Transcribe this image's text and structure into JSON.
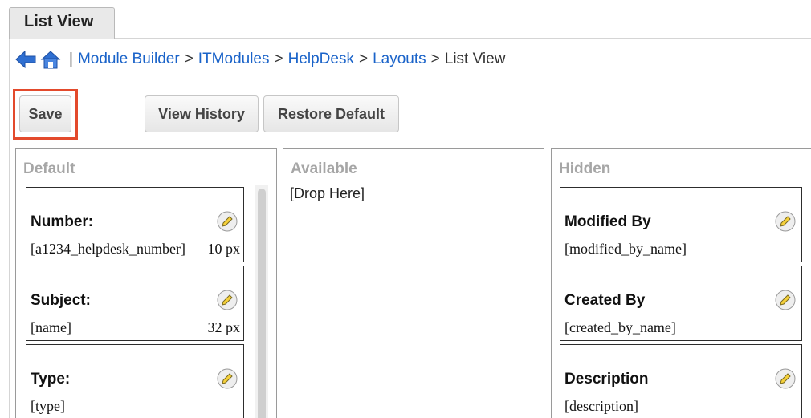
{
  "tab": {
    "label": "List View"
  },
  "breadcrumb": {
    "separator": "|",
    "links": [
      "Module Builder",
      "ITModules",
      "HelpDesk",
      "Layouts"
    ],
    "arrow": ">",
    "current": "List View"
  },
  "buttons": {
    "save": "Save",
    "view_history": "View History",
    "restore_default": "Restore Default"
  },
  "columns": {
    "default": {
      "title": "Default",
      "fields": [
        {
          "label": "Number:",
          "field": "[a1234_helpdesk_number]",
          "width": "10 px"
        },
        {
          "label": "Subject:",
          "field": "[name]",
          "width": "32 px"
        },
        {
          "label": "Type:",
          "field": "[type]",
          "width": ""
        }
      ]
    },
    "available": {
      "title": "Available",
      "drop_hint": "[Drop Here]"
    },
    "hidden": {
      "title": "Hidden",
      "fields": [
        {
          "label": "Modified By",
          "field": "[modified_by_name]"
        },
        {
          "label": "Created By",
          "field": "[created_by_name]"
        },
        {
          "label": "Description",
          "field": "[description]"
        }
      ]
    }
  },
  "colors": {
    "link": "#1a63c9",
    "highlight": "#e34a2c",
    "column_title": "#a6a6a6"
  },
  "icons": {
    "back": "back-arrow-icon",
    "home": "home-icon",
    "edit": "pencil-edit-icon"
  }
}
